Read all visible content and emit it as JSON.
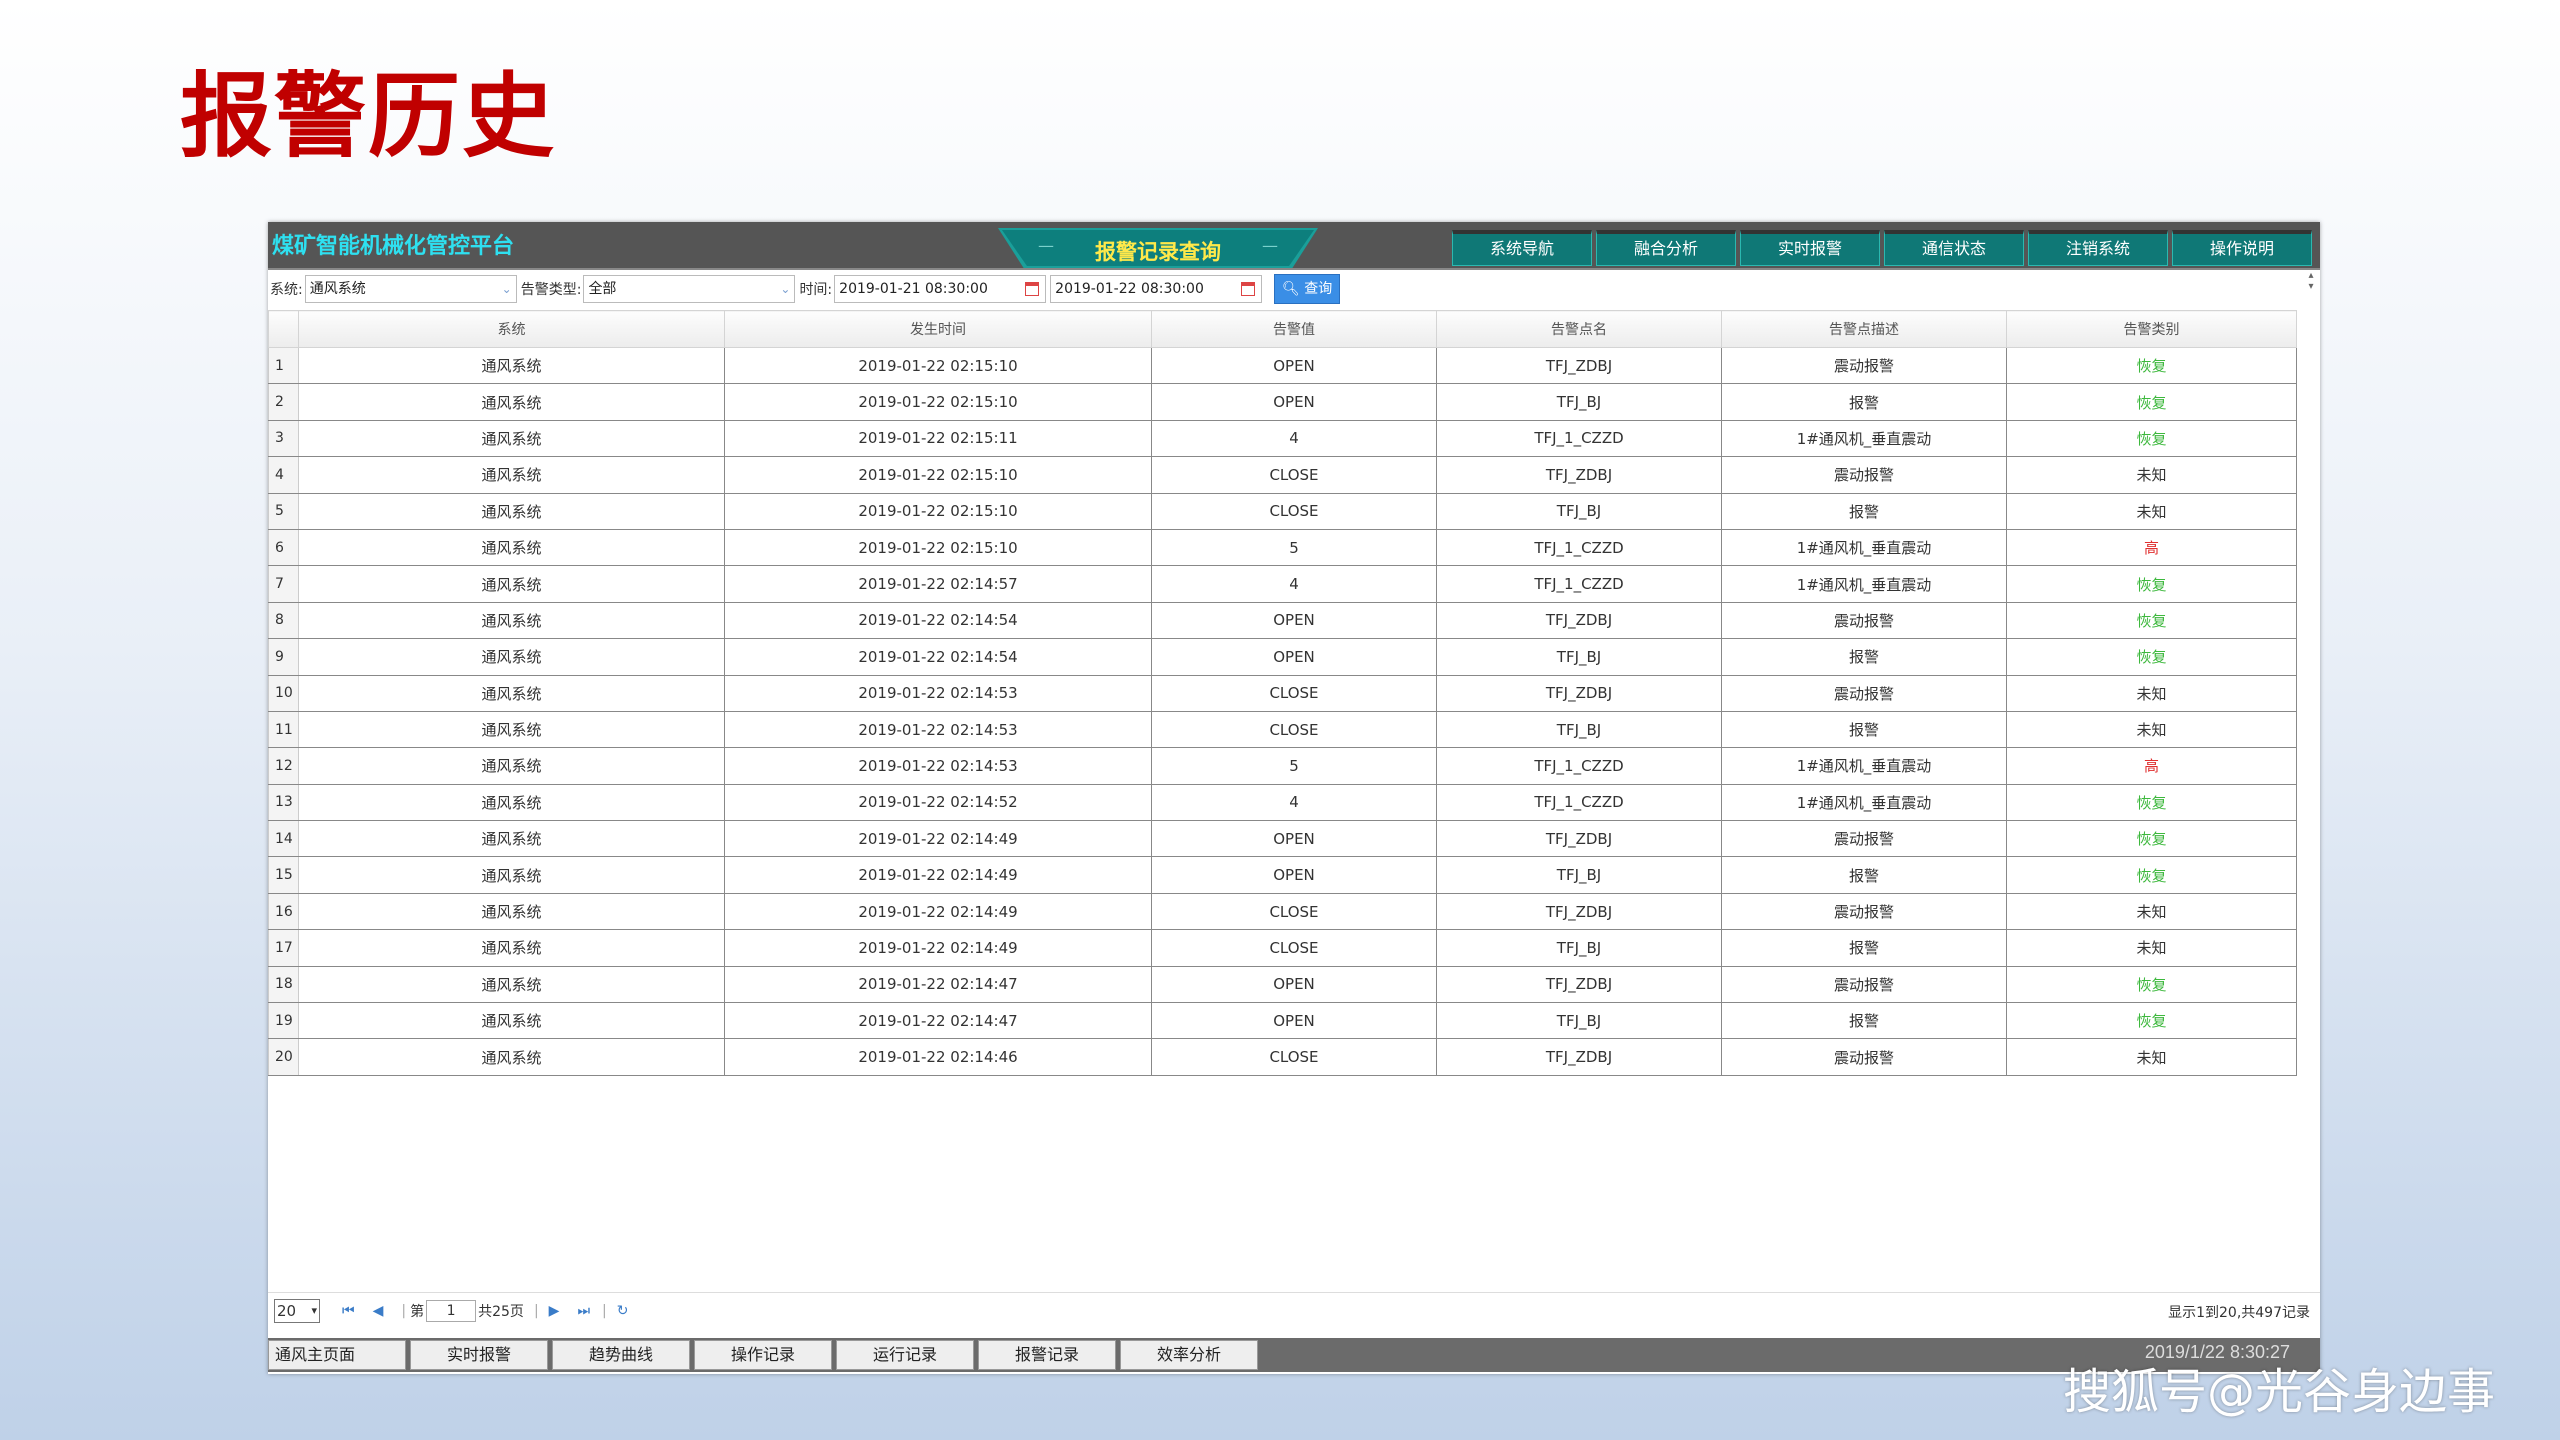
{
  "slide_title": "报警历史",
  "header": {
    "app_title": "煤矿智能机械化管控平台",
    "center_tab": "报警记录查询",
    "nav": [
      "系统导航",
      "融合分析",
      "实时报警",
      "通信状态",
      "注销系统",
      "操作说明"
    ]
  },
  "toolbar": {
    "system_label": "系统:",
    "system_value": "通风系统",
    "alarm_type_label": "告警类型:",
    "alarm_type_value": "全部",
    "time_label": "时间:",
    "start_time": "2019-01-21 08:30:00",
    "end_time": "2019-01-22 08:30:00",
    "query_label": "查询"
  },
  "table": {
    "headers": [
      "系统",
      "发生时间",
      "告警值",
      "告警点名",
      "告警点描述",
      "告警类别"
    ],
    "rows": [
      [
        "1",
        "通风系统",
        "2019-01-22 02:15:10",
        "OPEN",
        "TFJ_ZDBJ",
        "震动报警",
        "恢复"
      ],
      [
        "2",
        "通风系统",
        "2019-01-22 02:15:10",
        "OPEN",
        "TFJ_BJ",
        "报警",
        "恢复"
      ],
      [
        "3",
        "通风系统",
        "2019-01-22 02:15:11",
        "4",
        "TFJ_1_CZZD",
        "1#通风机_垂直震动",
        "恢复"
      ],
      [
        "4",
        "通风系统",
        "2019-01-22 02:15:10",
        "CLOSE",
        "TFJ_ZDBJ",
        "震动报警",
        "未知"
      ],
      [
        "5",
        "通风系统",
        "2019-01-22 02:15:10",
        "CLOSE",
        "TFJ_BJ",
        "报警",
        "未知"
      ],
      [
        "6",
        "通风系统",
        "2019-01-22 02:15:10",
        "5",
        "TFJ_1_CZZD",
        "1#通风机_垂直震动",
        "高"
      ],
      [
        "7",
        "通风系统",
        "2019-01-22 02:14:57",
        "4",
        "TFJ_1_CZZD",
        "1#通风机_垂直震动",
        "恢复"
      ],
      [
        "8",
        "通风系统",
        "2019-01-22 02:14:54",
        "OPEN",
        "TFJ_ZDBJ",
        "震动报警",
        "恢复"
      ],
      [
        "9",
        "通风系统",
        "2019-01-22 02:14:54",
        "OPEN",
        "TFJ_BJ",
        "报警",
        "恢复"
      ],
      [
        "10",
        "通风系统",
        "2019-01-22 02:14:53",
        "CLOSE",
        "TFJ_ZDBJ",
        "震动报警",
        "未知"
      ],
      [
        "11",
        "通风系统",
        "2019-01-22 02:14:53",
        "CLOSE",
        "TFJ_BJ",
        "报警",
        "未知"
      ],
      [
        "12",
        "通风系统",
        "2019-01-22 02:14:53",
        "5",
        "TFJ_1_CZZD",
        "1#通风机_垂直震动",
        "高"
      ],
      [
        "13",
        "通风系统",
        "2019-01-22 02:14:52",
        "4",
        "TFJ_1_CZZD",
        "1#通风机_垂直震动",
        "恢复"
      ],
      [
        "14",
        "通风系统",
        "2019-01-22 02:14:49",
        "OPEN",
        "TFJ_ZDBJ",
        "震动报警",
        "恢复"
      ],
      [
        "15",
        "通风系统",
        "2019-01-22 02:14:49",
        "OPEN",
        "TFJ_BJ",
        "报警",
        "恢复"
      ],
      [
        "16",
        "通风系统",
        "2019-01-22 02:14:49",
        "CLOSE",
        "TFJ_ZDBJ",
        "震动报警",
        "未知"
      ],
      [
        "17",
        "通风系统",
        "2019-01-22 02:14:49",
        "CLOSE",
        "TFJ_BJ",
        "报警",
        "未知"
      ],
      [
        "18",
        "通风系统",
        "2019-01-22 02:14:47",
        "OPEN",
        "TFJ_ZDBJ",
        "震动报警",
        "恢复"
      ],
      [
        "19",
        "通风系统",
        "2019-01-22 02:14:47",
        "OPEN",
        "TFJ_BJ",
        "报警",
        "恢复"
      ],
      [
        "20",
        "通风系统",
        "2019-01-22 02:14:46",
        "CLOSE",
        "TFJ_ZDBJ",
        "震动报警",
        "未知"
      ]
    ]
  },
  "category_colors": {
    "恢复": "#3db83d",
    "高": "#e03030",
    "未知": "#333333"
  },
  "pager": {
    "page_size": "20",
    "page_prefix": "第",
    "current_page": "1",
    "total_pages_text": "共25页",
    "summary": "显示1到20,共497记录"
  },
  "bottom_nav": [
    "通风主页面",
    "实时报警",
    "趋势曲线",
    "操作记录",
    "运行记录",
    "报警记录",
    "效率分析"
  ],
  "datetime": "2019/1/22    8:30:27",
  "watermark": "搜狐号@光谷身边事",
  "icons": {
    "dropdown": "chevron-down-icon",
    "calendar": "calendar-icon",
    "search": "search-icon",
    "pager": [
      "first-page-icon",
      "prev-page-icon",
      "next-page-icon",
      "last-page-icon",
      "refresh-icon"
    ]
  }
}
